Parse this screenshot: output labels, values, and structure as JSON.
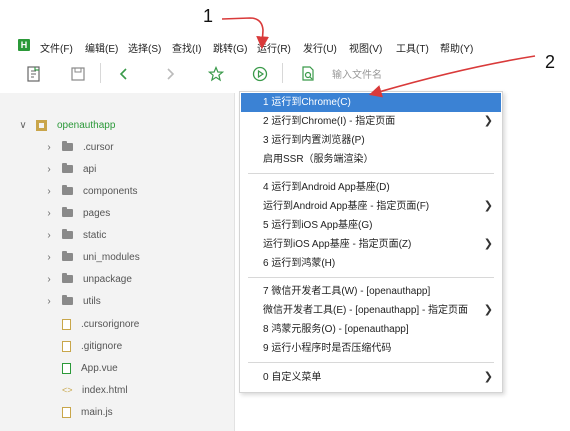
{
  "menubar": {
    "logo": "H",
    "items": [
      "文件(F)",
      "编辑(E)",
      "选择(S)",
      "查找(I)",
      "跳转(G)",
      "运行(R)",
      "发行(U)",
      "视图(V)",
      "工具(T)",
      "帮助(Y)"
    ]
  },
  "toolbar": {
    "search_placeholder": "输入文件名"
  },
  "tree": {
    "root": "openauthapp",
    "folders": [
      ".cursor",
      "api",
      "components",
      "pages",
      "static",
      "uni_modules",
      "unpackage",
      "utils"
    ],
    "files": [
      ".cursorignore",
      ".gitignore",
      "App.vue",
      "index.html",
      "main.js"
    ]
  },
  "menu": {
    "items": [
      "1 运行到Chrome(C)",
      "2 运行到Chrome(I) - 指定页面",
      "3 运行到内置浏览器(P)",
      "启用SSR（服务端渲染）",
      "4 运行到Android App基座(D)",
      "运行到Android App基座 - 指定页面(F)",
      "5 运行到iOS App基座(G)",
      "运行到iOS App基座 - 指定页面(Z)",
      "6 运行到鸿蒙(H)",
      "7 微信开发者工具(W) - [openauthapp]",
      "微信开发者工具(E) - [openauthapp] - 指定页面",
      "8 鸿蒙元服务(O) - [openauthapp]",
      "9 运行小程序时是否压缩代码",
      "0 自定义菜单"
    ]
  },
  "annotations": {
    "one": "1",
    "two": "2"
  },
  "colors": {
    "highlight": "#3b82d4",
    "logo": "#2b9939",
    "toolbar_icon": "#3a9a4a",
    "annotation": "#d93a3a"
  }
}
